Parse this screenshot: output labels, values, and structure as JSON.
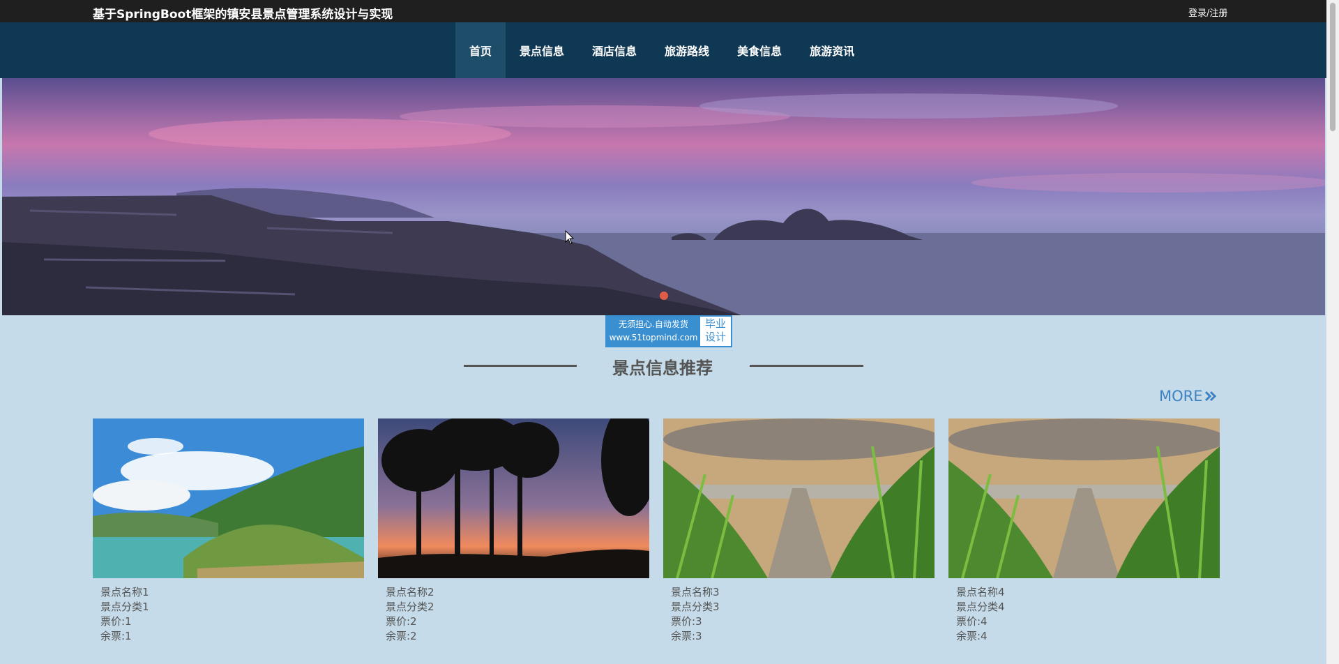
{
  "header": {
    "title": "基于SpringBoot框架的镇安县景点管理系统设计与实现",
    "login": "登录/注册"
  },
  "nav": {
    "items": [
      {
        "label": "首页",
        "active": true
      },
      {
        "label": "景点信息",
        "active": false
      },
      {
        "label": "酒店信息",
        "active": false
      },
      {
        "label": "旅游路线",
        "active": false
      },
      {
        "label": "美食信息",
        "active": false
      },
      {
        "label": "旅游资讯",
        "active": false
      }
    ]
  },
  "watermark": {
    "line1": "无须担心.自动发货",
    "line2": "www.51topmind.com",
    "side1": "毕业",
    "side2": "设计"
  },
  "section": {
    "title": "景点信息推荐",
    "more": "MORE"
  },
  "cards": [
    {
      "name": "景点名称1",
      "category": "景点分类1",
      "price": "票价:1",
      "remaining": "余票:1"
    },
    {
      "name": "景点名称2",
      "category": "景点分类2",
      "price": "票价:2",
      "remaining": "余票:2"
    },
    {
      "name": "景点名称3",
      "category": "景点分类3",
      "price": "票价:3",
      "remaining": "余票:3"
    },
    {
      "name": "景点名称4",
      "category": "景点分类4",
      "price": "票价:4",
      "remaining": "余票:4"
    }
  ],
  "colors": {
    "topbar": "#1f1f1f",
    "navbar": "#0f3854",
    "page_background": "#c5dbe9",
    "more_link": "#3f82c0"
  }
}
